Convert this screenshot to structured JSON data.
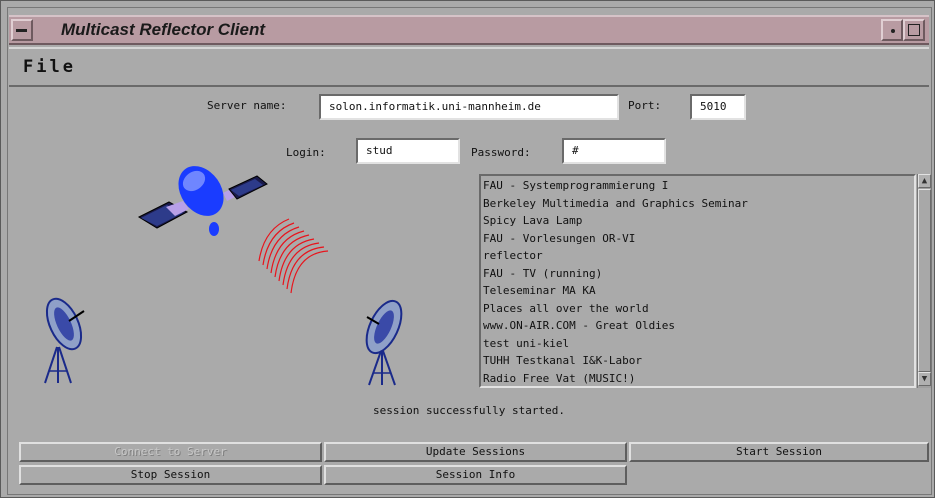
{
  "window": {
    "title": "Multicast Reflector Client"
  },
  "menu": {
    "file": "File"
  },
  "form": {
    "server_label": "Server name:",
    "server_value": "solon.informatik.uni-mannheim.de",
    "port_label": "Port:",
    "port_value": "5010",
    "login_label": "Login:",
    "login_value": "stud",
    "password_label": "Password:",
    "password_value": "#"
  },
  "sessions": [
    "FAU - Systemprogrammierung I",
    "Berkeley Multimedia and Graphics Seminar",
    "Spicy Lava Lamp",
    "FAU - Vorlesungen OR-VI",
    "reflector",
    "FAU - TV (running)",
    "Teleseminar MA KA",
    "Places all over the world",
    "www.ON-AIR.COM - Great Oldies",
    "test uni-kiel",
    "TUHH Testkanal I&K-Labor",
    "Radio Free Vat (MUSIC!)"
  ],
  "status": "session successfully started.",
  "buttons": {
    "connect": "Connect to Server",
    "update": "Update Sessions",
    "start": "Start Session",
    "stop": "Stop Session",
    "info": "Session Info"
  },
  "colors": {
    "titlebar": "#b89ba2",
    "background": "#aaaaaa",
    "signal": "#e8141c",
    "satellite": "#1a3cff"
  }
}
